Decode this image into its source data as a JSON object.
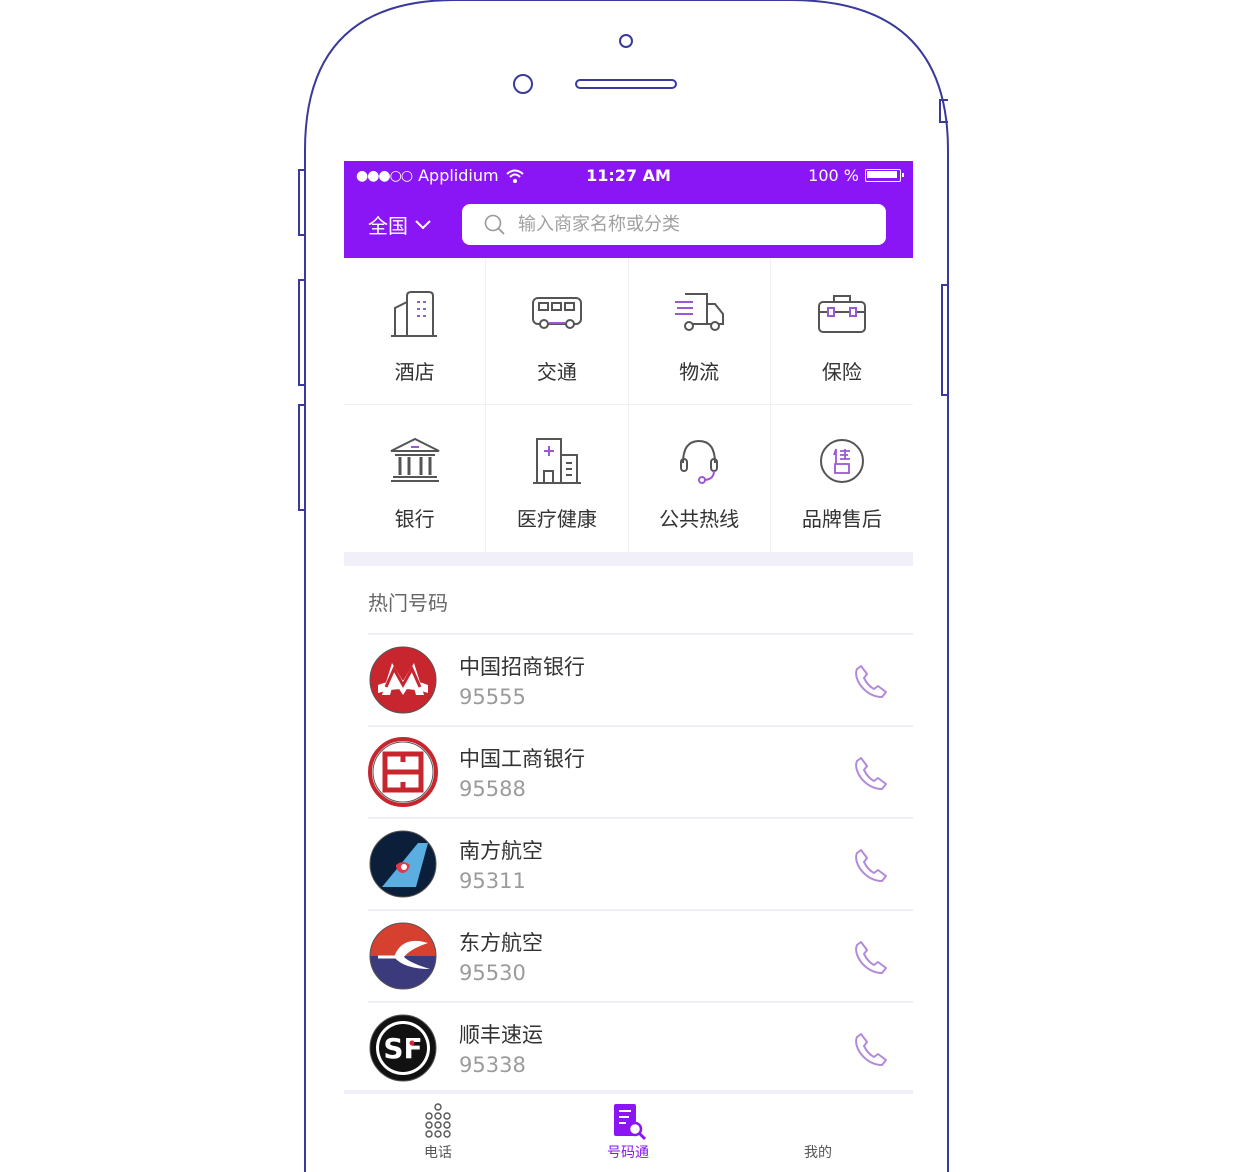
{
  "status_bar": {
    "signal": "●●●○○",
    "carrier": "Applidium",
    "time": "11:27 AM",
    "battery": "100 %"
  },
  "header": {
    "region": "全国",
    "search_placeholder": "输入商家名称或分类"
  },
  "categories": [
    {
      "label": "酒店",
      "icon": "hotel-building-icon"
    },
    {
      "label": "交通",
      "icon": "bus-icon"
    },
    {
      "label": "物流",
      "icon": "truck-icon"
    },
    {
      "label": "保险",
      "icon": "briefcase-icon"
    },
    {
      "label": "银行",
      "icon": "bank-icon"
    },
    {
      "label": "医疗健康",
      "icon": "hospital-icon"
    },
    {
      "label": "公共热线",
      "icon": "headset-icon"
    },
    {
      "label": "品牌售后",
      "icon": "after-sales-icon"
    }
  ],
  "hot_numbers": {
    "title": "热门号码",
    "items": [
      {
        "name": "中国招商银行",
        "number": "95555",
        "logo": "cmb-logo"
      },
      {
        "name": "中国工商银行",
        "number": "95588",
        "logo": "icbc-logo"
      },
      {
        "name": "南方航空",
        "number": "95311",
        "logo": "china-southern-logo"
      },
      {
        "name": "东方航空",
        "number": "95530",
        "logo": "china-eastern-logo"
      },
      {
        "name": "顺丰速运",
        "number": "95338",
        "logo": "sf-express-logo"
      }
    ]
  },
  "tabbar": {
    "tabs": [
      {
        "label": "电话",
        "icon": "dialpad-icon"
      },
      {
        "label": "号码通",
        "icon": "directory-search-icon",
        "active": true
      },
      {
        "label": "我的",
        "icon": "profile-icon"
      }
    ]
  },
  "colors": {
    "accent": "#8a16f5",
    "icon_stroke": "#555555",
    "icon_accent": "#9b59d0",
    "frame": "#3a3a9a"
  }
}
